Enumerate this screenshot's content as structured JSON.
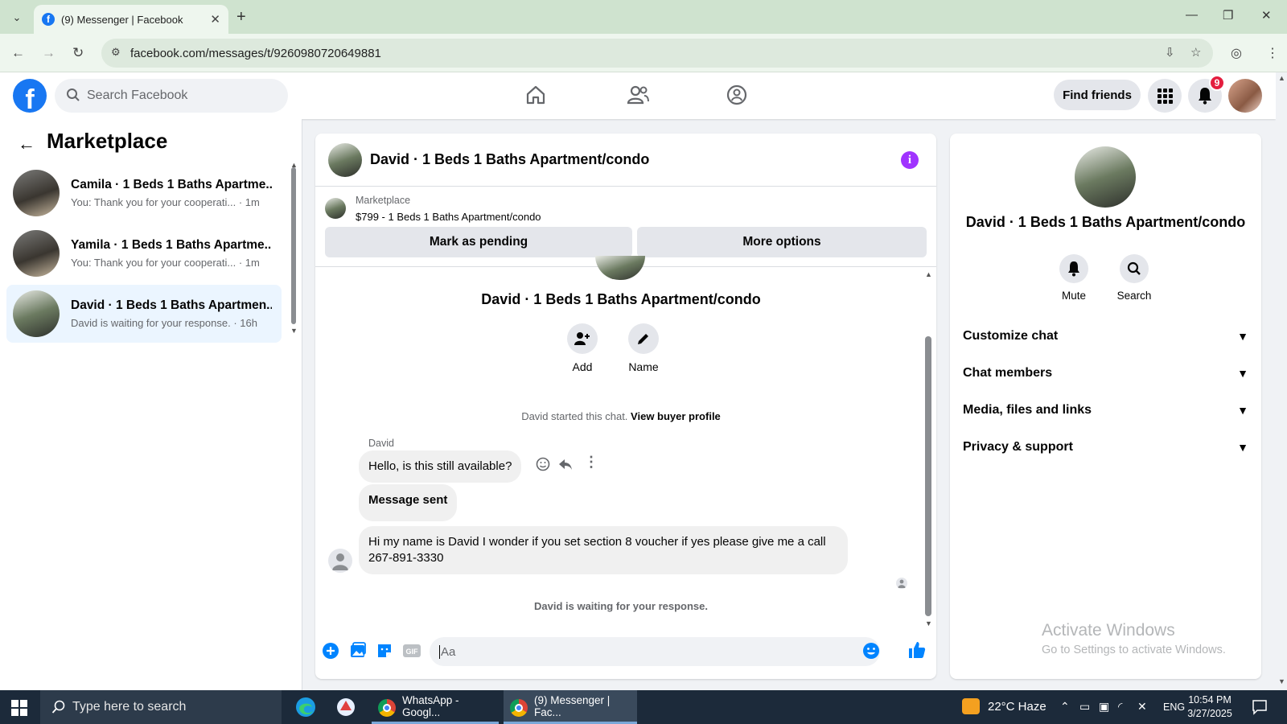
{
  "browser": {
    "tab_title": "(9) Messenger | Facebook",
    "url": "facebook.com/messages/t/9260980720649881"
  },
  "header": {
    "search_placeholder": "Search Facebook",
    "find_friends": "Find friends",
    "notifications_count": "9"
  },
  "sidebar": {
    "title": "Marketplace",
    "conversations": [
      {
        "name": "Camila · 1 Beds 1 Baths Apartme...",
        "snippet": "You: Thank you for your cooperati... · 1m"
      },
      {
        "name": "Yamila · 1 Beds 1 Baths Apartme...",
        "snippet": "You: Thank you for your cooperati... · 1m"
      },
      {
        "name": "David · 1 Beds 1 Baths Apartmen...",
        "snippet": "David is waiting for your response. · 16h"
      }
    ]
  },
  "chat": {
    "title": "David · 1 Beds 1 Baths Apartment/condo",
    "marketplace_label": "Marketplace",
    "listing": "$799 - 1 Beds 1 Baths Apartment/condo",
    "mark_pending": "Mark as pending",
    "more_options": "More options",
    "header_name": "David · 1 Beds 1 Baths Apartment/condo",
    "add_label": "Add",
    "name_label": "Name",
    "started_text": "David started this chat.",
    "view_profile": "View buyer profile",
    "sender": "David",
    "messages": [
      "Hello, is this still available?",
      "Message sent",
      "Hi my name is David I wonder if you set section 8 voucher if yes please give me a call 267-891-3330"
    ],
    "waiting": "David is waiting for your response.",
    "input_placeholder": "Aa"
  },
  "details": {
    "name": "David · 1 Beds 1 Baths Apartment/condo",
    "mute": "Mute",
    "search": "Search",
    "sections": [
      "Customize chat",
      "Chat members",
      "Media, files and links",
      "Privacy & support"
    ]
  },
  "watermark": {
    "title": "Activate Windows",
    "subtitle": "Go to Settings to activate Windows."
  },
  "taskbar": {
    "search": "Type here to search",
    "apps": [
      "WhatsApp - Googl...",
      "(9) Messenger | Fac..."
    ],
    "weather": "22°C  Haze",
    "lang": "ENG",
    "time": "10:54 PM",
    "date": "3/27/2025"
  },
  "colors": {
    "brand": "#1877f2",
    "messenger_accent": "#0084ff",
    "info_purple": "#a033ff"
  }
}
